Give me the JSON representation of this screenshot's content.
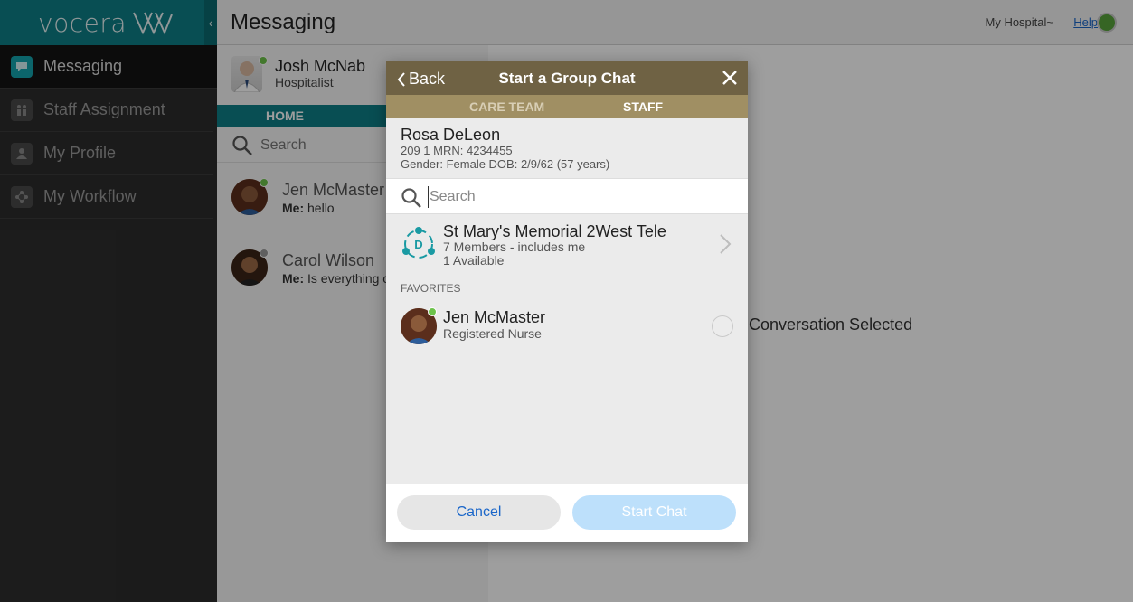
{
  "brand": {
    "logo_text": "vocera",
    "accent": "#0d7f86",
    "collapse_icon": "chevron-left-icon"
  },
  "sidebar": {
    "items": [
      {
        "label": "Messaging",
        "icon": "chat-bubble-icon",
        "active": true
      },
      {
        "label": "Staff Assignment",
        "icon": "staff-icon",
        "active": false
      },
      {
        "label": "My Profile",
        "icon": "person-icon",
        "active": false
      },
      {
        "label": "My Workflow",
        "icon": "workflow-icon",
        "active": false
      }
    ]
  },
  "header": {
    "title": "Messaging",
    "hospital": "My Hospital~",
    "help": "Help",
    "status_color": "#57a43a"
  },
  "list": {
    "user": {
      "name": "Josh McNab",
      "role": "Hospitalist"
    },
    "home_tab": "HOME",
    "search_placeholder": "Search",
    "conversations": [
      {
        "name": "Jen McMaster",
        "sender": "Me:",
        "message": "hello",
        "online": true
      },
      {
        "name": "Carol Wilson",
        "sender": "Me:",
        "message": "Is everything o",
        "online": false
      }
    ]
  },
  "main": {
    "empty_text": "Conversation Selected"
  },
  "dialog": {
    "back": "Back",
    "title": "Start a Group Chat",
    "tabs": {
      "care_team": "CARE TEAM",
      "staff": "STAFF"
    },
    "patient": {
      "name": "Rosa DeLeon",
      "line1": "209 1 MRN: 4234455",
      "line2": "Gender: Female DOB: 2/9/62 (57 years)"
    },
    "search_placeholder": "Search",
    "group": {
      "name": "St Mary's Memorial 2West Tele",
      "members": "7 Members - includes me",
      "available": "1 Available",
      "icon_letter": "D"
    },
    "favorites_header": "FAVORITES",
    "favorite": {
      "name": "Jen McMaster",
      "role": "Registered Nurse",
      "online": true
    },
    "cancel": "Cancel",
    "start_chat": "Start Chat"
  }
}
